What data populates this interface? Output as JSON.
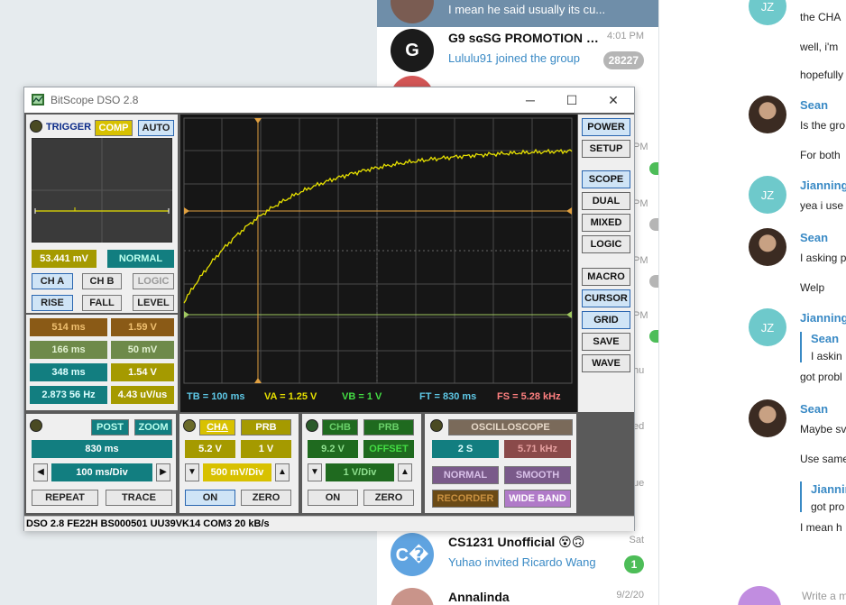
{
  "chat_list": [
    {
      "name": "",
      "snippet": "I mean he said usually its cu...",
      "time": "",
      "badge": "",
      "active": true,
      "avatar_text": "",
      "avatar_color": "#7a5c52"
    },
    {
      "name": "G9 sɢSG PROMOTION G...",
      "snippet": "Lululu91 joined the group",
      "time": "4:01 PM",
      "badge": "28227",
      "active": false,
      "avatar_text": "G",
      "avatar_color": "#1b1b1b"
    },
    {
      "name": "CS1231 Unofficial 😵🙃",
      "snippet": "Yuhao invited Ricardo Wang",
      "time": "Sat",
      "badge": "1",
      "active": false,
      "avatar_text": "C�",
      "avatar_color": "#5fa3e0"
    },
    {
      "name": "Annalinda",
      "snippet": "",
      "time": "9/2/20",
      "badge": "",
      "active": false,
      "avatar_text": "",
      "avatar_color": "#c9948a"
    }
  ],
  "chat_edge_fragments": [
    "PM",
    "PM",
    "PM",
    "PM",
    "hu",
    "ed",
    "ue"
  ],
  "messages": {
    "lines": [
      {
        "kind": "text",
        "text": "the CHA"
      },
      {
        "kind": "text",
        "text": "well, i'm"
      },
      {
        "kind": "text",
        "text": "hopefully"
      },
      {
        "kind": "sender",
        "text": "Sean"
      },
      {
        "kind": "text",
        "text": "Is the gro"
      },
      {
        "kind": "text",
        "text": "For both"
      },
      {
        "kind": "sender",
        "text": "Jianning"
      },
      {
        "kind": "text",
        "text": "yea i use"
      },
      {
        "kind": "sender",
        "text": "Sean"
      },
      {
        "kind": "text",
        "text": "I asking p"
      },
      {
        "kind": "text",
        "text": "Welp"
      },
      {
        "kind": "sender",
        "text": "Jianning"
      },
      {
        "kind": "quote_name",
        "text": "Sean"
      },
      {
        "kind": "quote_text",
        "text": "I askin"
      },
      {
        "kind": "text",
        "text": "got probl"
      },
      {
        "kind": "sender",
        "text": "Sean"
      },
      {
        "kind": "text",
        "text": "Maybe sv"
      },
      {
        "kind": "text",
        "text": "Use same"
      },
      {
        "kind": "quote_name",
        "text": "Jiannin"
      },
      {
        "kind": "quote_text",
        "text": "got pro"
      },
      {
        "kind": "text",
        "text": "I mean h"
      }
    ],
    "avatar_initials": [
      "JZ",
      "JZ",
      "JZ"
    ],
    "input_placeholder": "Write a m"
  },
  "bitscope": {
    "title": "BitScope DSO 2.8",
    "window_controls": {
      "minimize": "─",
      "maximize": "☐",
      "close": "✕"
    },
    "trigger": {
      "trigger_label": "TRIGGER",
      "comp_label": "COMP",
      "auto_label": "AUTO",
      "level_value": "53.441 mV",
      "mode_value": "NORMAL",
      "ch_a": "CH A",
      "ch_b": "CH B",
      "logic": "LOGIC",
      "rise": "RISE",
      "fall": "FALL",
      "level": "LEVEL"
    },
    "measurements": [
      {
        "left": "514 ms",
        "right": "1.59 V"
      },
      {
        "left": "166 ms",
        "right": "50 mV"
      },
      {
        "left": "348 ms",
        "right": "1.54 V"
      },
      {
        "left": "2.873 56 Hz",
        "right": "4.43 uV/us"
      }
    ],
    "scope_readout": {
      "tb": "TB = 100 ms",
      "va": "VA = 1.25 V",
      "vb": "VB = 1 V",
      "ft": "FT = 830 ms",
      "fs": "FS = 5.28 kHz"
    },
    "side_buttons": [
      "POWER",
      "SETUP",
      "SCOPE",
      "DUAL",
      "MIXED",
      "LOGIC",
      "MACRO",
      "CURSOR",
      "GRID",
      "SAVE",
      "WAVE"
    ],
    "timebase": {
      "post": "POST",
      "zoom": "ZOOM",
      "delay": "830 ms",
      "rate": "100 ms/Div",
      "repeat": "REPEAT",
      "trace": "TRACE"
    },
    "channel_a": {
      "cha": "CHA",
      "prb": "PRB",
      "range": "5.2 V",
      "probe": "1 V",
      "scale": "500 mV/Div",
      "on": "ON",
      "zero": "ZERO"
    },
    "channel_b": {
      "chb": "CHB",
      "prb": "PRB",
      "range": "9.2 V",
      "offset": "OFFSET",
      "scale": "1 V/Div",
      "on": "ON",
      "zero": "ZERO"
    },
    "mode": {
      "oscilloscope": "OSCILLOSCOPE",
      "duration": "2 S",
      "freq": "5.71 kHz",
      "normal": "NORMAL",
      "smooth": "SMOOTH",
      "recorder": "RECORDER",
      "wideband": "WIDE BAND"
    },
    "status": "DSO 2.8 FE22H BS000501 UU39VK14 COM3 20 kB/s"
  },
  "waveform": {
    "trace": "charging curve rising from 0 toward ~1.5 divisions below top",
    "colors": {
      "trace": "#e6e000",
      "cursor_a": "#e0a040",
      "cursor_b": "#a0c860",
      "grid": "#4a4a4a",
      "screen": "#161616"
    }
  }
}
